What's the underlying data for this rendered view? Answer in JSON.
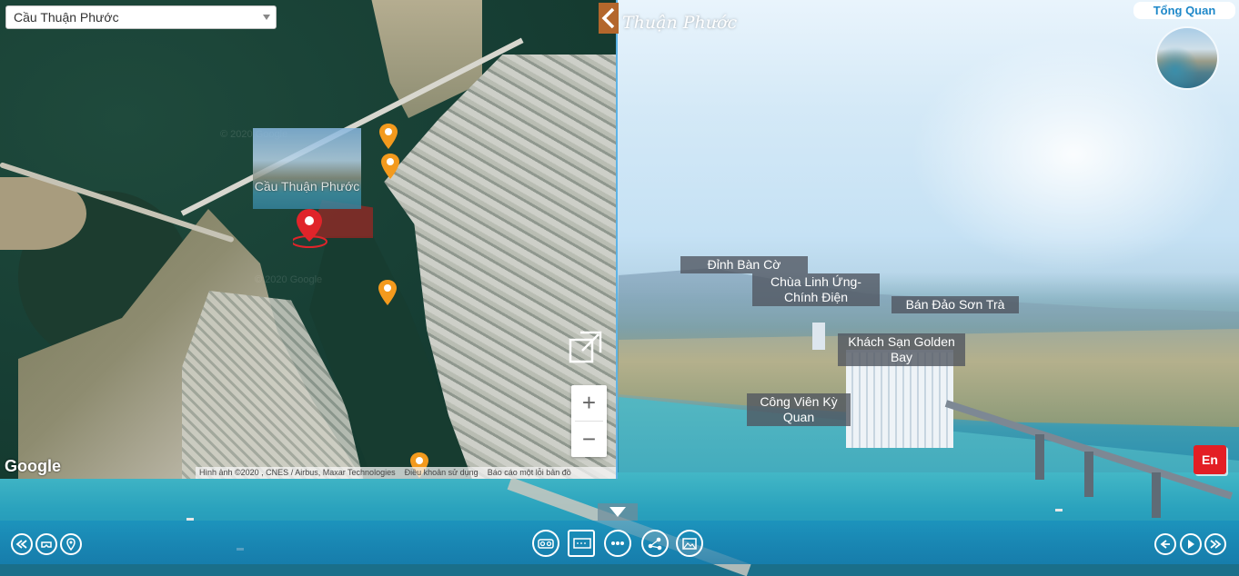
{
  "pano": {
    "title": "Thuận Phước",
    "overview_label": "Tổng Quan",
    "language_label": "En"
  },
  "hotspots": [
    {
      "label": "Đỉnh Bàn Cờ"
    },
    {
      "label": "Chùa Linh Ứng-Chính Điện"
    },
    {
      "label": "Bán Đảo Sơn Trà"
    },
    {
      "label": "Khách Sạn Golden Bay"
    },
    {
      "label": "Công Viên Kỳ Quan"
    }
  ],
  "map": {
    "selected_location": "Cầu Thuận Phước",
    "preview_caption": "Cầu Thuận Phước",
    "zoom_in": "+",
    "zoom_out": "−",
    "google_logo": "Google",
    "watermark": "© 2020 Google",
    "attribution": {
      "imagery": "Hình ảnh ©2020 , CNES / Airbus, Maxar Technologies",
      "terms": "Điều khoản sử dụng",
      "report": "Báo cáo một lỗi bản đồ"
    }
  },
  "toolbar": {
    "left": [
      "rewind-icon",
      "vr-headset-icon",
      "map-pin-icon"
    ],
    "center": [
      "vr-glasses-icon",
      "floorplan-icon",
      "more-icon",
      "share-icon",
      "gallery-icon"
    ],
    "right": [
      "back-icon",
      "play-icon",
      "fast-forward-icon"
    ]
  },
  "colors": {
    "accent": "#1e88c9",
    "pin_red": "#e0242a",
    "pin_orange": "#f39a1d",
    "collapse": "#b3672c",
    "language": "#e31e24"
  }
}
